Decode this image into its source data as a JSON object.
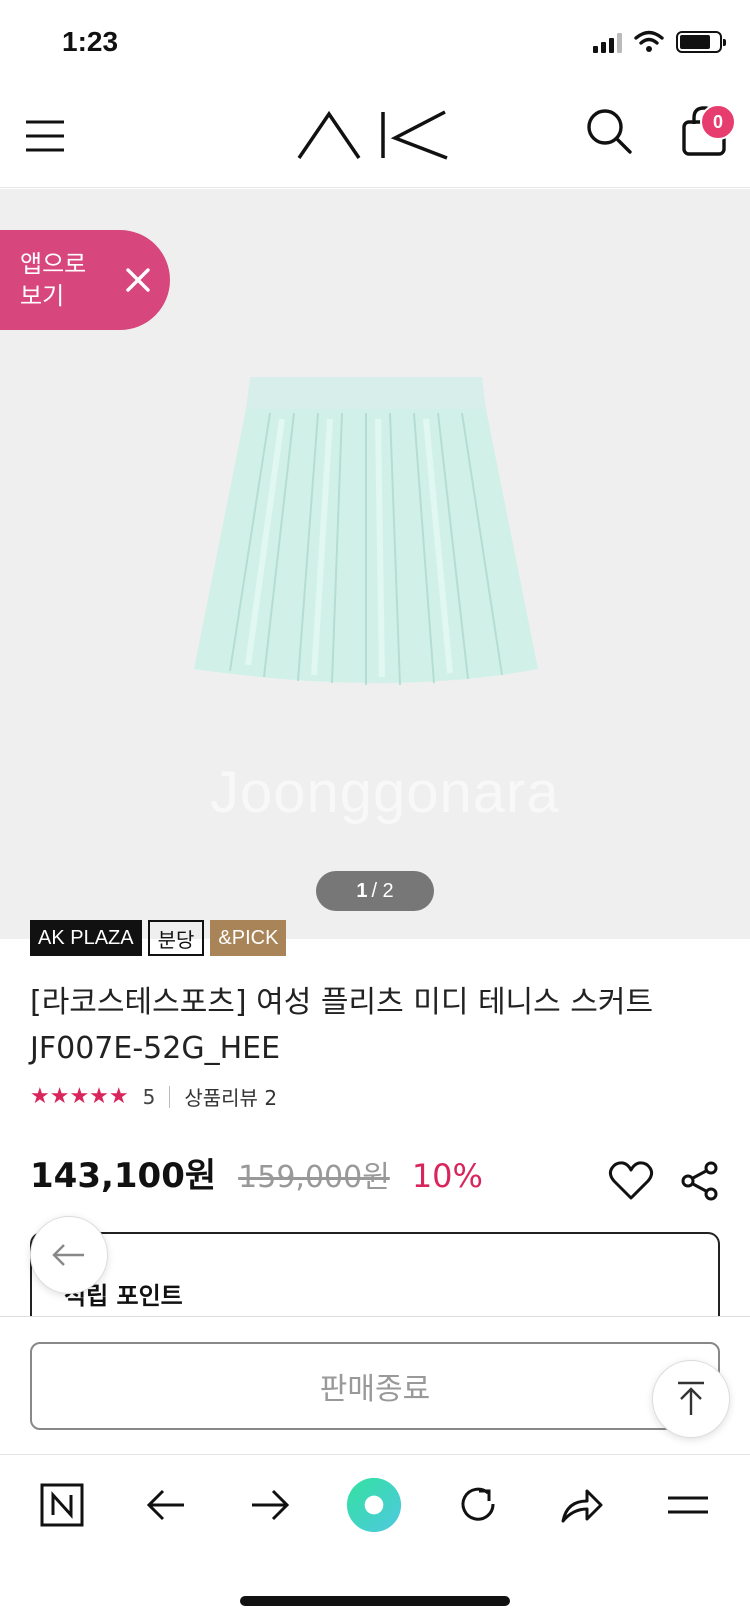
{
  "status": {
    "time": "1:23"
  },
  "header": {
    "logo_alt": "AK",
    "cart_count": "0"
  },
  "app_banner": {
    "label": "앱으로 보기"
  },
  "gallery": {
    "current": "1",
    "separator": "/ 2",
    "watermark": "Joonggonara"
  },
  "badges": {
    "store": "AK PLAZA",
    "branch": "분당",
    "pick": "&PICK"
  },
  "product": {
    "title": "[라코스테스포츠] 여성 플리츠 미디 테니스 스커트 JF007E-52G_HEE",
    "rating_score": "5",
    "review_label": "상품리뷰 2",
    "price": "143,100원",
    "original_price": "159,000원",
    "discount": "10%"
  },
  "points": {
    "label": "적립 포인트"
  },
  "actions": {
    "sold_out_label": "판매종료"
  },
  "colors": {
    "accent": "#d8265d",
    "banner": "#d8467e",
    "pick_badge": "#a98459"
  }
}
